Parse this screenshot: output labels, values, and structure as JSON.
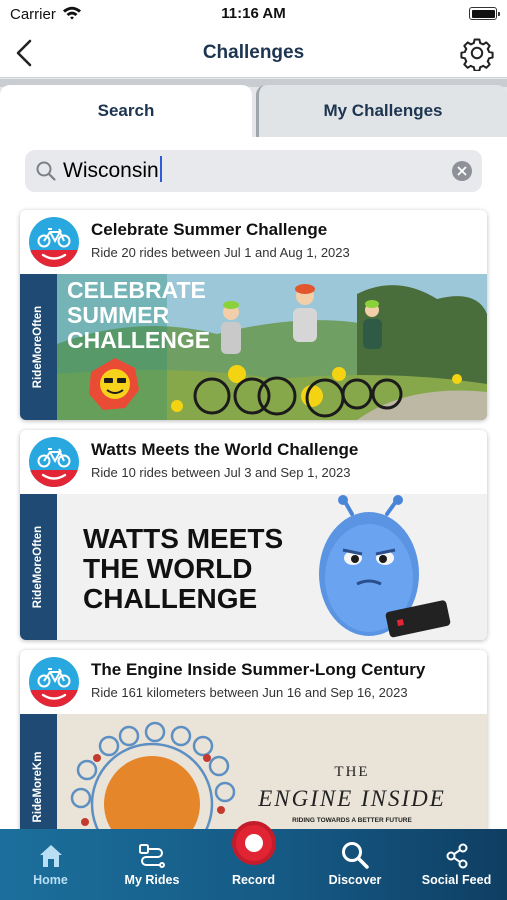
{
  "status": {
    "carrier": "Carrier",
    "time": "11:16 AM"
  },
  "nav": {
    "title": "Challenges"
  },
  "tabs": [
    {
      "label": "Search",
      "active": true
    },
    {
      "label": "My Challenges",
      "active": false
    }
  ],
  "search": {
    "value": "Wisconsin"
  },
  "cards": [
    {
      "title": "Celebrate Summer Challenge",
      "subtitle": "Ride 20 rides between Jul  1 and Aug 1, 2023",
      "side_label": "RideMoreOften",
      "banner_lines": [
        "CELEBRATE",
        "SUMMER",
        "CHALLENGE"
      ]
    },
    {
      "title": "Watts Meets the World Challenge",
      "subtitle": "Ride 10 rides between Jul  3 and Sep 1, 2023",
      "side_label": "RideMoreOften",
      "banner_lines": [
        "WATTS MEETS",
        "THE WORLD",
        "CHALLENGE"
      ]
    },
    {
      "title": "The Engine Inside Summer-Long Century",
      "subtitle": "Ride 161 kilometers between Jun  16 and Sep 16, 2023",
      "side_label": "RideMoreKm",
      "banner_lines": [
        "THE",
        "ENGINE INSIDE",
        "RIDING TOWARDS A BETTER FUTURE"
      ]
    }
  ],
  "tabbar": [
    {
      "label": "Home",
      "icon": "home-icon"
    },
    {
      "label": "My Rides",
      "icon": "route-icon"
    },
    {
      "label": "Record",
      "icon": "record-icon"
    },
    {
      "label": "Discover",
      "icon": "search-icon"
    },
    {
      "label": "Social Feed",
      "icon": "share-icon"
    }
  ],
  "colors": {
    "navy": "#1d3550",
    "side_strip": "#1e4a73",
    "logo_blue": "#29a8e0",
    "logo_red": "#e32636",
    "record_red": "#e02433",
    "tabbar": "#155a85"
  }
}
